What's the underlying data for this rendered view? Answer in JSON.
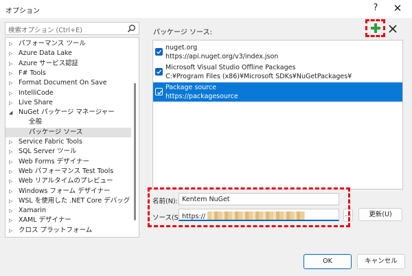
{
  "window": {
    "title": "オプション",
    "help_glyph": "?",
    "close_glyph": "✕"
  },
  "search": {
    "placeholder": "検索オプション (Ctrl+E)",
    "icon": "magnifier-icon"
  },
  "tree": {
    "items": [
      {
        "label": "パフォーマンス ツール",
        "level": 0,
        "state": "collapsed"
      },
      {
        "label": "Azure Data Lake",
        "level": 0,
        "state": "collapsed"
      },
      {
        "label": "Azure サービス認証",
        "level": 0,
        "state": "collapsed"
      },
      {
        "label": "F# Tools",
        "level": 0,
        "state": "collapsed"
      },
      {
        "label": "Format Document On Save",
        "level": 0,
        "state": "collapsed"
      },
      {
        "label": "IntelliCode",
        "level": 0,
        "state": "collapsed"
      },
      {
        "label": "Live Share",
        "level": 0,
        "state": "collapsed"
      },
      {
        "label": "NuGet パッケージ マネージャー",
        "level": 0,
        "state": "expanded"
      },
      {
        "label": "全般",
        "level": 1,
        "state": "leaf"
      },
      {
        "label": "パッケージ ソース",
        "level": 1,
        "state": "leaf",
        "selected": true
      },
      {
        "label": "Service Fabric Tools",
        "level": 0,
        "state": "collapsed"
      },
      {
        "label": "SQL Server ツール",
        "level": 0,
        "state": "collapsed"
      },
      {
        "label": "Web Forms デザイナー",
        "level": 0,
        "state": "collapsed"
      },
      {
        "label": "Web パフォーマンス Test Tools",
        "level": 0,
        "state": "collapsed"
      },
      {
        "label": "Web リアルタイムのプレビュー",
        "level": 0,
        "state": "collapsed"
      },
      {
        "label": "Windows フォーム デザイナー",
        "level": 0,
        "state": "collapsed"
      },
      {
        "label": "WSL を使用した .NET Core デバッグ",
        "level": 0,
        "state": "collapsed"
      },
      {
        "label": "Xamarin",
        "level": 0,
        "state": "collapsed"
      },
      {
        "label": "XAML デザイナー",
        "level": 0,
        "state": "collapsed"
      },
      {
        "label": "クロス プラットフォーム",
        "level": 0,
        "state": "collapsed"
      }
    ]
  },
  "sources_panel": {
    "label": "パッケージ ソース:",
    "add_icon": "plus-icon",
    "remove_icon": "x-icon",
    "sources": [
      {
        "name": "nuget.org",
        "url": "https://api.nuget.org/v3/index.json",
        "checked": true,
        "selected": false
      },
      {
        "name": "Microsoft Visual Studio Offline Packages",
        "url": "C:¥Program Files (x86)¥Microsoft SDKs¥NuGetPackages¥",
        "checked": true,
        "selected": false
      },
      {
        "name": "Package source",
        "url": "https://packagesource",
        "checked": true,
        "selected": true
      }
    ]
  },
  "form": {
    "name_label": "名前(N):",
    "name_value": "Kentem NuGet",
    "source_label": "ソース(S):",
    "source_value": "https://",
    "browse_label": "...",
    "update_label": "更新(U)"
  },
  "footer": {
    "ok_label": "OK",
    "cancel_label": "キャンセル"
  },
  "colors": {
    "accent": "#0a78d7",
    "callout": "#e60012",
    "add_green": "#2e9e3e"
  }
}
